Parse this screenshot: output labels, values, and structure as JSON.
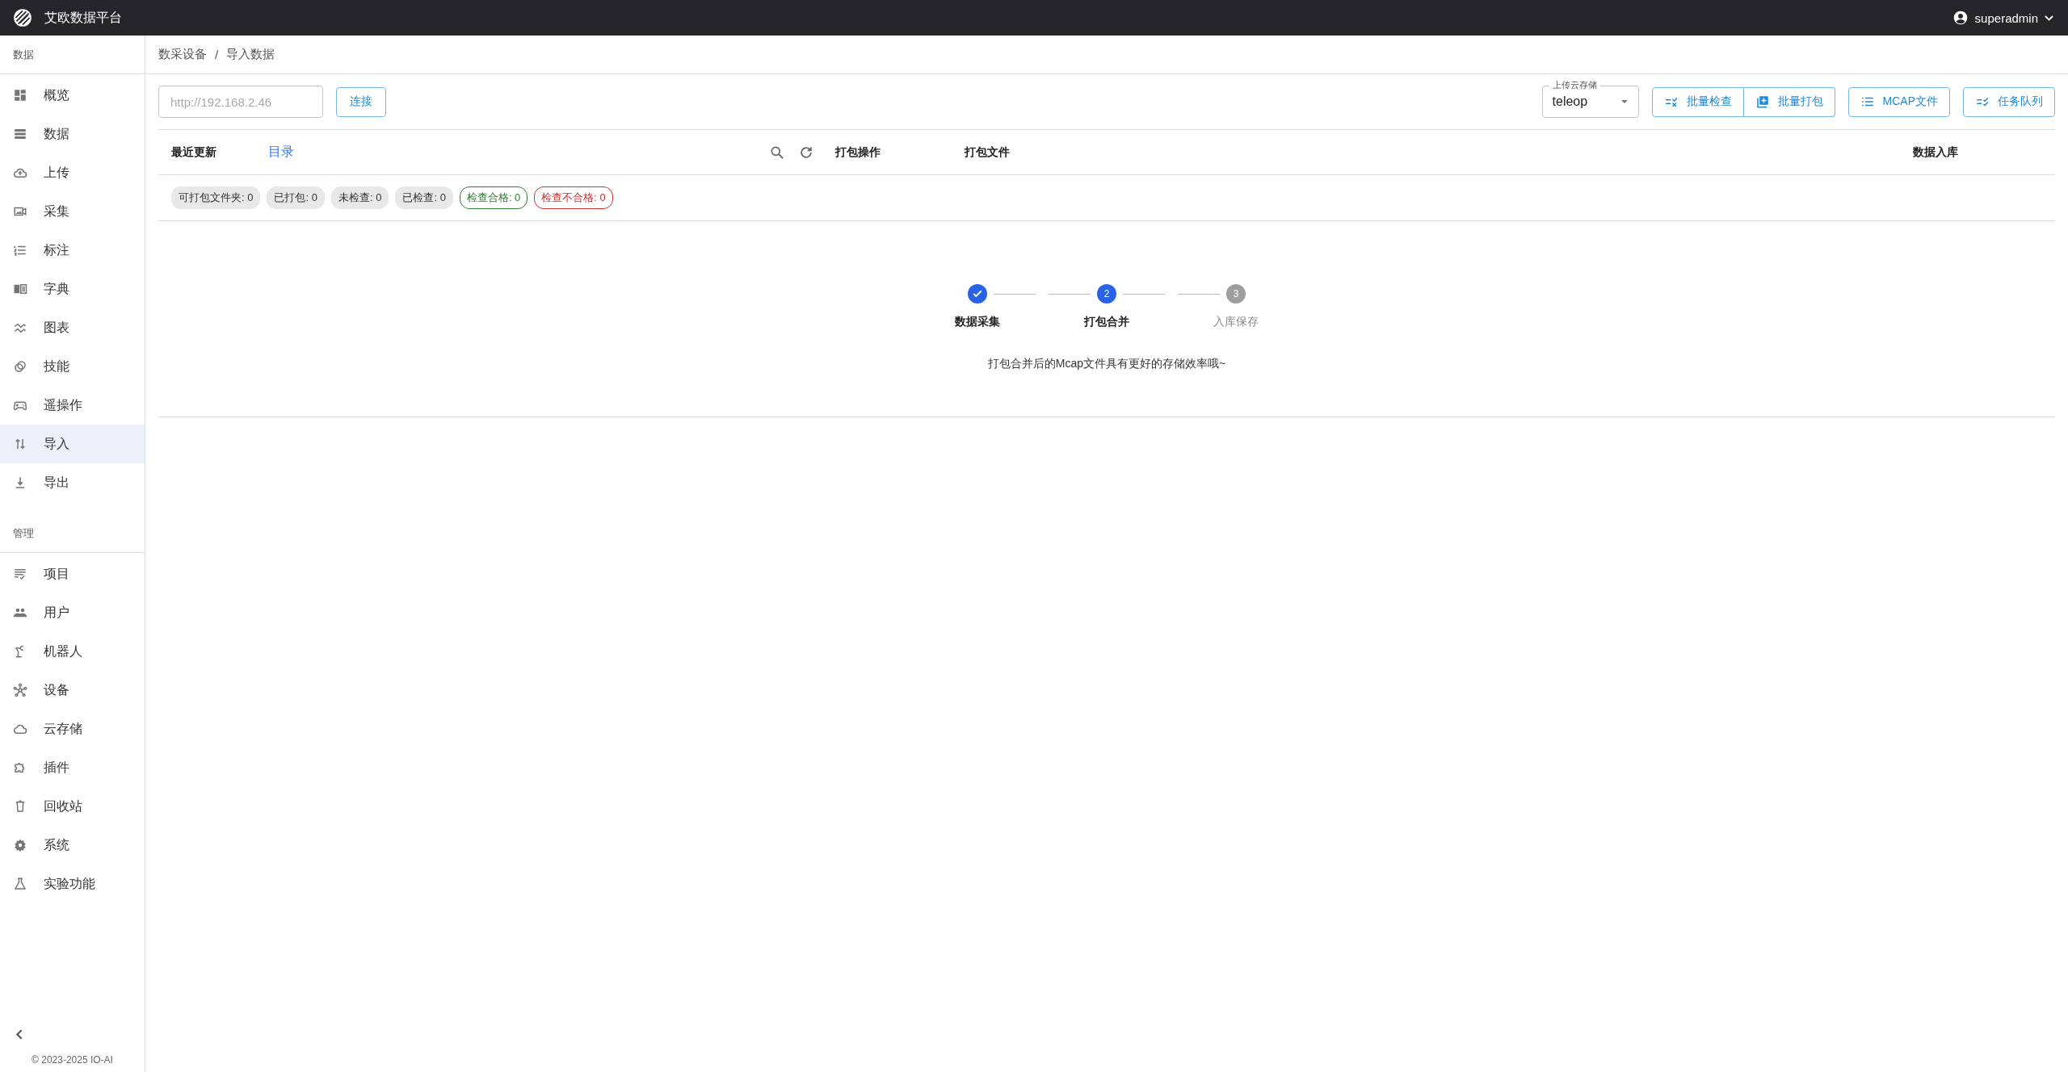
{
  "app": {
    "title": "艾欧数据平台",
    "user": "superadmin"
  },
  "sidebar": {
    "sections": [
      {
        "title": "数据",
        "items": [
          {
            "label": "概览",
            "selected": false
          },
          {
            "label": "数据",
            "selected": false
          },
          {
            "label": "上传",
            "selected": false
          },
          {
            "label": "采集",
            "selected": false
          },
          {
            "label": "标注",
            "selected": false
          },
          {
            "label": "字典",
            "selected": false
          },
          {
            "label": "图表",
            "selected": false
          },
          {
            "label": "技能",
            "selected": false
          },
          {
            "label": "遥操作",
            "selected": false
          },
          {
            "label": "导入",
            "selected": true
          },
          {
            "label": "导出",
            "selected": false
          }
        ]
      },
      {
        "title": "管理",
        "items": [
          {
            "label": "项目",
            "selected": false
          },
          {
            "label": "用户",
            "selected": false
          },
          {
            "label": "机器人",
            "selected": false
          },
          {
            "label": "设备",
            "selected": false
          },
          {
            "label": "云存储",
            "selected": false
          },
          {
            "label": "插件",
            "selected": false
          },
          {
            "label": "回收站",
            "selected": false
          },
          {
            "label": "系统",
            "selected": false
          },
          {
            "label": "实验功能",
            "selected": false
          }
        ]
      }
    ],
    "footer": "© 2023-2025 IO-AI"
  },
  "breadcrumb": [
    "数采设备",
    "导入数据"
  ],
  "breadcrumb_separator": "/",
  "toolbar": {
    "address": {
      "placeholder": "http://192.168.2.46"
    },
    "connect": "连接",
    "storage": {
      "label": "上传云存储",
      "value": "teleop"
    },
    "buttons": [
      "批量检查",
      "批量打包",
      "MCAP文件",
      "任务队列"
    ]
  },
  "table": {
    "columns": [
      "最近更新",
      "目录",
      "打包操作",
      "打包文件",
      "数据入库"
    ],
    "badges": [
      {
        "text": "可打包文件夹: 0",
        "kind": "neutral"
      },
      {
        "text": "已打包: 0",
        "kind": "neutral"
      },
      {
        "text": "未检查: 0",
        "kind": "neutral"
      },
      {
        "text": "已检查: 0",
        "kind": "neutral"
      },
      {
        "text": "检查合格: 0",
        "kind": "success"
      },
      {
        "text": "检查不合格: 0",
        "kind": "error"
      }
    ]
  },
  "steps": [
    {
      "label": "数据采集",
      "completed": true,
      "active": false
    },
    {
      "label": "打包合并",
      "number": "2",
      "completed": false,
      "active": true
    },
    {
      "label": "入库保存",
      "number": "3",
      "completed": false,
      "active": false
    }
  ],
  "hint": "打包合并后的Mcap文件具有更好的存储效率哦~"
}
